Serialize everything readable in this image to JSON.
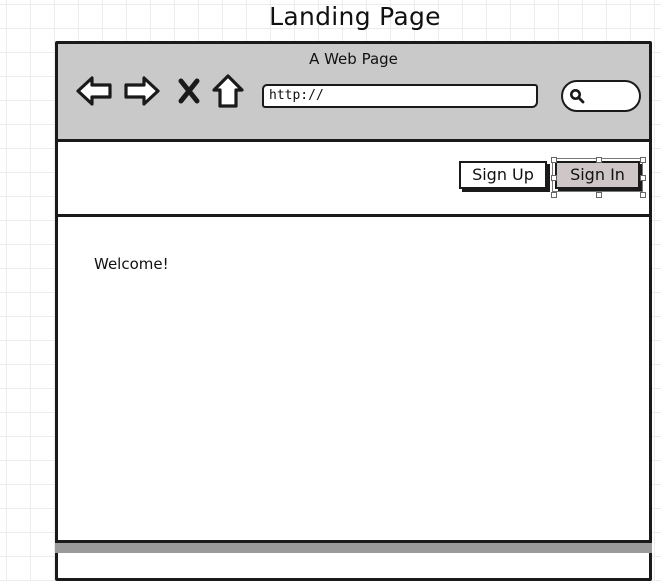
{
  "canvas": {
    "title": "Landing Page"
  },
  "browser": {
    "window_title": "A Web Page",
    "url_value": "http://",
    "icons": {
      "back": "back-arrow-icon",
      "forward": "forward-arrow-icon",
      "stop": "close-icon",
      "home": "home-icon",
      "search": "search-icon"
    }
  },
  "header": {
    "sign_up_label": "Sign Up",
    "sign_in_label": "Sign In"
  },
  "content": {
    "welcome_text": "Welcome!"
  },
  "colors": {
    "toolbar": "#c9c9c9",
    "sign_in_fill": "#cfc7c7",
    "stroke": "#1a1a1a"
  }
}
